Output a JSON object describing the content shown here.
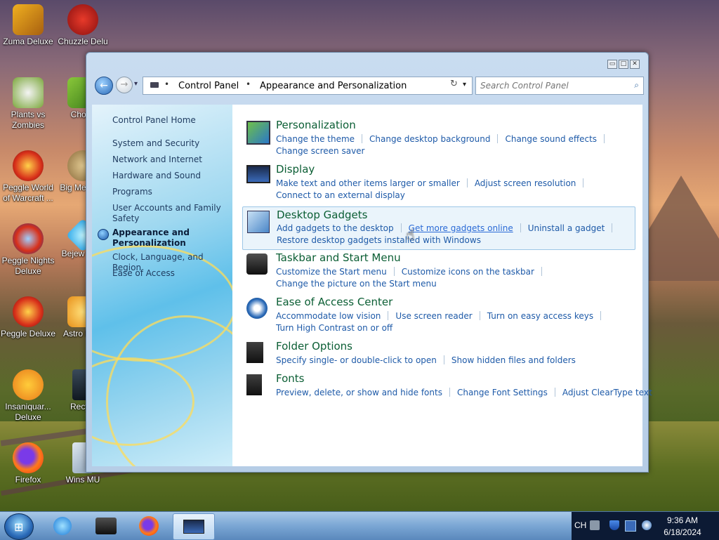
{
  "desktop": {
    "icons": [
      {
        "label": "Zuma Deluxe"
      },
      {
        "label": "Chuzzle Delu"
      },
      {
        "label": "Plants vs Zombies"
      },
      {
        "label": "Chomi"
      },
      {
        "label": "Peggle World of Warcraft ..."
      },
      {
        "label": "Big Me Delu"
      },
      {
        "label": "Peggle Nights Deluxe"
      },
      {
        "label": "Bejew Delu"
      },
      {
        "label": "Peggle Deluxe"
      },
      {
        "label": "Astro Delu"
      },
      {
        "label": "Insaniquar... Deluxe"
      },
      {
        "label": "Recycl"
      },
      {
        "label": "Firefox"
      },
      {
        "label": "Wins MU"
      }
    ]
  },
  "window": {
    "controls": {
      "minimize": "▭",
      "maximize": "□",
      "close": "✕"
    },
    "address": {
      "crumbs": [
        "Control Panel",
        "Appearance and Personalization"
      ],
      "separator": "•",
      "dropdown": "▾"
    },
    "search": {
      "placeholder": "Search Control Panel",
      "icon": "search-icon"
    },
    "nav": {
      "back": "←",
      "forward": "→",
      "history": "▾",
      "refresh": "↻"
    }
  },
  "left_pane": {
    "items": [
      {
        "label": "Control Panel Home"
      },
      {
        "label": "System and Security"
      },
      {
        "label": "Network and Internet"
      },
      {
        "label": "Hardware and Sound"
      },
      {
        "label": "Programs"
      },
      {
        "label": "User Accounts and Family Safety"
      },
      {
        "label": "Appearance and Personalization",
        "current": true
      },
      {
        "label": "Clock, Language, and Region"
      },
      {
        "label": "Ease of Access"
      }
    ]
  },
  "categories": [
    {
      "title": "Personalization",
      "links": [
        [
          "Change the theme",
          "Change desktop background",
          "Change sound effects"
        ],
        [
          "Change screen saver"
        ]
      ]
    },
    {
      "title": "Display",
      "links": [
        [
          "Make text and other items larger or smaller",
          "Adjust screen resolution"
        ],
        [
          "Connect to an external display"
        ]
      ]
    },
    {
      "title": "Desktop Gadgets",
      "highlighted": true,
      "links": [
        [
          "Add gadgets to the desktop",
          "Get more gadgets online",
          "Uninstall a gadget"
        ],
        [
          "Restore desktop gadgets installed with Windows"
        ]
      ]
    },
    {
      "title": "Taskbar and Start Menu",
      "links": [
        [
          "Customize the Start menu",
          "Customize icons on the taskbar"
        ],
        [
          "Change the picture on the Start menu"
        ]
      ]
    },
    {
      "title": "Ease of Access Center",
      "links": [
        [
          "Accommodate low vision",
          "Use screen reader",
          "Turn on easy access keys"
        ],
        [
          "Turn High Contrast on or off"
        ]
      ]
    },
    {
      "title": "Folder Options",
      "links": [
        [
          "Specify single- or double-click to open",
          "Show hidden files and folders"
        ]
      ]
    },
    {
      "title": "Fonts",
      "links": [
        [
          "Preview, delete, or show and hide fonts",
          "Change Font Settings",
          "Adjust ClearType text"
        ]
      ]
    }
  ],
  "taskbar": {
    "start_glyph": "⊞",
    "tray": {
      "language": "CH",
      "time": "9:36 AM",
      "date": "6/18/2024"
    }
  },
  "colors": {
    "link": "#1e5aa8",
    "category_title": "#0b5e34",
    "taskbar": "#7aa6d4"
  }
}
